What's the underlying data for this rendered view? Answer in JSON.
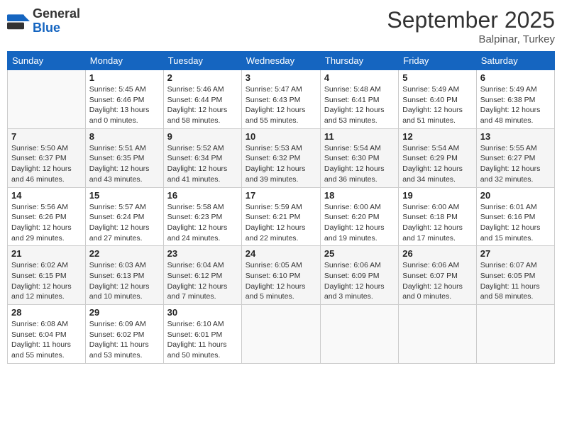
{
  "header": {
    "logo_general": "General",
    "logo_blue": "Blue",
    "month": "September 2025",
    "location": "Balpinar, Turkey"
  },
  "weekdays": [
    "Sunday",
    "Monday",
    "Tuesday",
    "Wednesday",
    "Thursday",
    "Friday",
    "Saturday"
  ],
  "weeks": [
    [
      {
        "day": "",
        "empty": true
      },
      {
        "day": "1",
        "sunrise": "Sunrise: 5:45 AM",
        "sunset": "Sunset: 6:46 PM",
        "daylight": "Daylight: 13 hours and 0 minutes."
      },
      {
        "day": "2",
        "sunrise": "Sunrise: 5:46 AM",
        "sunset": "Sunset: 6:44 PM",
        "daylight": "Daylight: 12 hours and 58 minutes."
      },
      {
        "day": "3",
        "sunrise": "Sunrise: 5:47 AM",
        "sunset": "Sunset: 6:43 PM",
        "daylight": "Daylight: 12 hours and 55 minutes."
      },
      {
        "day": "4",
        "sunrise": "Sunrise: 5:48 AM",
        "sunset": "Sunset: 6:41 PM",
        "daylight": "Daylight: 12 hours and 53 minutes."
      },
      {
        "day": "5",
        "sunrise": "Sunrise: 5:49 AM",
        "sunset": "Sunset: 6:40 PM",
        "daylight": "Daylight: 12 hours and 51 minutes."
      },
      {
        "day": "6",
        "sunrise": "Sunrise: 5:49 AM",
        "sunset": "Sunset: 6:38 PM",
        "daylight": "Daylight: 12 hours and 48 minutes."
      }
    ],
    [
      {
        "day": "7",
        "sunrise": "Sunrise: 5:50 AM",
        "sunset": "Sunset: 6:37 PM",
        "daylight": "Daylight: 12 hours and 46 minutes."
      },
      {
        "day": "8",
        "sunrise": "Sunrise: 5:51 AM",
        "sunset": "Sunset: 6:35 PM",
        "daylight": "Daylight: 12 hours and 43 minutes."
      },
      {
        "day": "9",
        "sunrise": "Sunrise: 5:52 AM",
        "sunset": "Sunset: 6:34 PM",
        "daylight": "Daylight: 12 hours and 41 minutes."
      },
      {
        "day": "10",
        "sunrise": "Sunrise: 5:53 AM",
        "sunset": "Sunset: 6:32 PM",
        "daylight": "Daylight: 12 hours and 39 minutes."
      },
      {
        "day": "11",
        "sunrise": "Sunrise: 5:54 AM",
        "sunset": "Sunset: 6:30 PM",
        "daylight": "Daylight: 12 hours and 36 minutes."
      },
      {
        "day": "12",
        "sunrise": "Sunrise: 5:54 AM",
        "sunset": "Sunset: 6:29 PM",
        "daylight": "Daylight: 12 hours and 34 minutes."
      },
      {
        "day": "13",
        "sunrise": "Sunrise: 5:55 AM",
        "sunset": "Sunset: 6:27 PM",
        "daylight": "Daylight: 12 hours and 32 minutes."
      }
    ],
    [
      {
        "day": "14",
        "sunrise": "Sunrise: 5:56 AM",
        "sunset": "Sunset: 6:26 PM",
        "daylight": "Daylight: 12 hours and 29 minutes."
      },
      {
        "day": "15",
        "sunrise": "Sunrise: 5:57 AM",
        "sunset": "Sunset: 6:24 PM",
        "daylight": "Daylight: 12 hours and 27 minutes."
      },
      {
        "day": "16",
        "sunrise": "Sunrise: 5:58 AM",
        "sunset": "Sunset: 6:23 PM",
        "daylight": "Daylight: 12 hours and 24 minutes."
      },
      {
        "day": "17",
        "sunrise": "Sunrise: 5:59 AM",
        "sunset": "Sunset: 6:21 PM",
        "daylight": "Daylight: 12 hours and 22 minutes."
      },
      {
        "day": "18",
        "sunrise": "Sunrise: 6:00 AM",
        "sunset": "Sunset: 6:20 PM",
        "daylight": "Daylight: 12 hours and 19 minutes."
      },
      {
        "day": "19",
        "sunrise": "Sunrise: 6:00 AM",
        "sunset": "Sunset: 6:18 PM",
        "daylight": "Daylight: 12 hours and 17 minutes."
      },
      {
        "day": "20",
        "sunrise": "Sunrise: 6:01 AM",
        "sunset": "Sunset: 6:16 PM",
        "daylight": "Daylight: 12 hours and 15 minutes."
      }
    ],
    [
      {
        "day": "21",
        "sunrise": "Sunrise: 6:02 AM",
        "sunset": "Sunset: 6:15 PM",
        "daylight": "Daylight: 12 hours and 12 minutes."
      },
      {
        "day": "22",
        "sunrise": "Sunrise: 6:03 AM",
        "sunset": "Sunset: 6:13 PM",
        "daylight": "Daylight: 12 hours and 10 minutes."
      },
      {
        "day": "23",
        "sunrise": "Sunrise: 6:04 AM",
        "sunset": "Sunset: 6:12 PM",
        "daylight": "Daylight: 12 hours and 7 minutes."
      },
      {
        "day": "24",
        "sunrise": "Sunrise: 6:05 AM",
        "sunset": "Sunset: 6:10 PM",
        "daylight": "Daylight: 12 hours and 5 minutes."
      },
      {
        "day": "25",
        "sunrise": "Sunrise: 6:06 AM",
        "sunset": "Sunset: 6:09 PM",
        "daylight": "Daylight: 12 hours and 3 minutes."
      },
      {
        "day": "26",
        "sunrise": "Sunrise: 6:06 AM",
        "sunset": "Sunset: 6:07 PM",
        "daylight": "Daylight: 12 hours and 0 minutes."
      },
      {
        "day": "27",
        "sunrise": "Sunrise: 6:07 AM",
        "sunset": "Sunset: 6:05 PM",
        "daylight": "Daylight: 11 hours and 58 minutes."
      }
    ],
    [
      {
        "day": "28",
        "sunrise": "Sunrise: 6:08 AM",
        "sunset": "Sunset: 6:04 PM",
        "daylight": "Daylight: 11 hours and 55 minutes."
      },
      {
        "day": "29",
        "sunrise": "Sunrise: 6:09 AM",
        "sunset": "Sunset: 6:02 PM",
        "daylight": "Daylight: 11 hours and 53 minutes."
      },
      {
        "day": "30",
        "sunrise": "Sunrise: 6:10 AM",
        "sunset": "Sunset: 6:01 PM",
        "daylight": "Daylight: 11 hours and 50 minutes."
      },
      {
        "day": "",
        "empty": true
      },
      {
        "day": "",
        "empty": true
      },
      {
        "day": "",
        "empty": true
      },
      {
        "day": "",
        "empty": true
      }
    ]
  ]
}
